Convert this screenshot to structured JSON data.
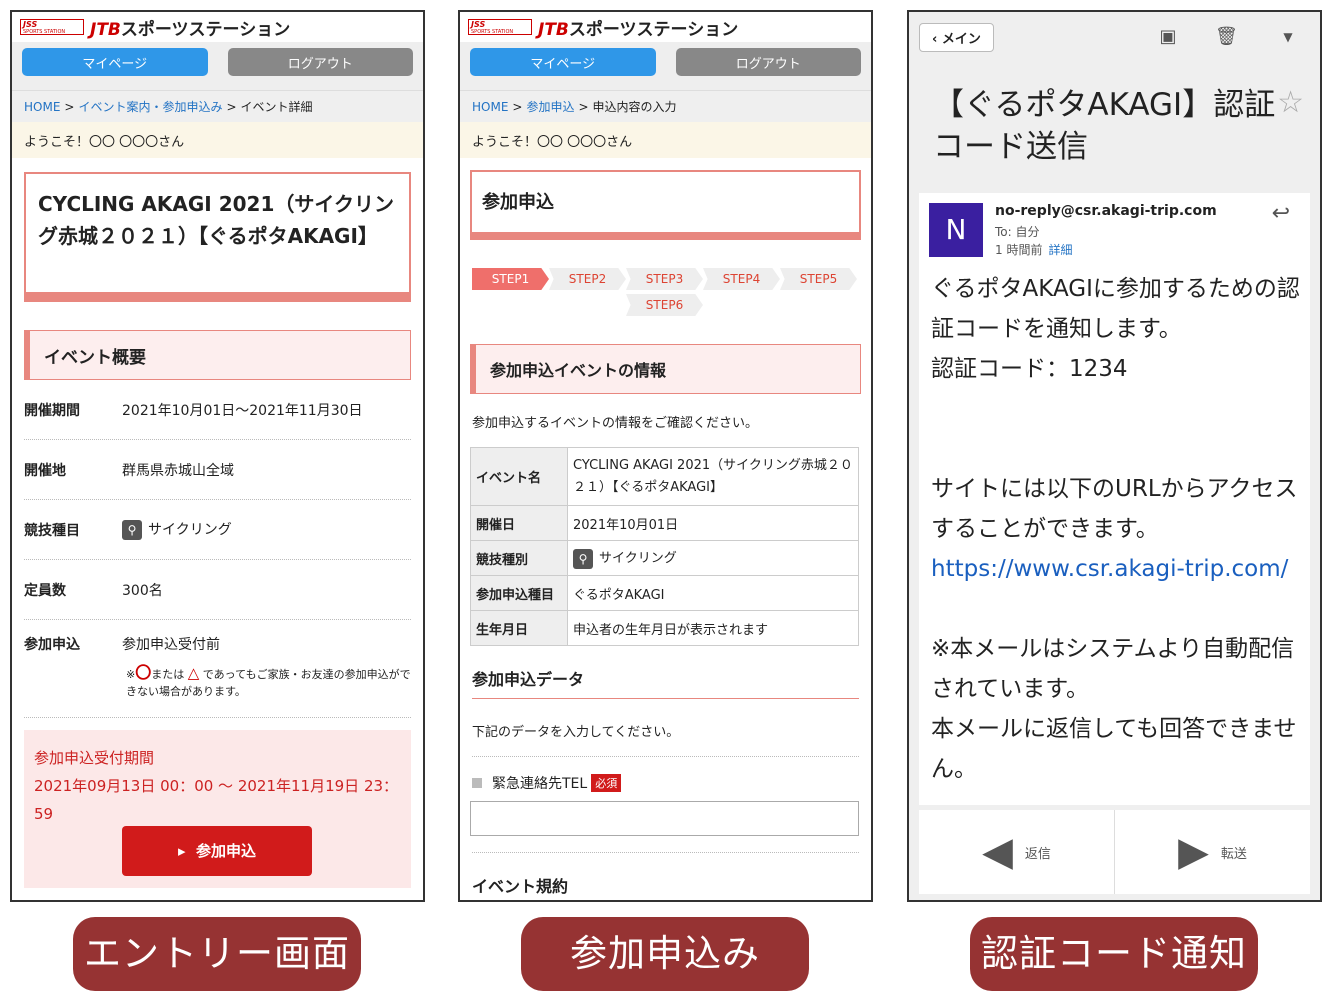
{
  "header": {
    "logo_line1": "JSS",
    "logo_line2": "SPORTS STATION",
    "brand_jtb": "JTB",
    "brand_rest": "スポーツステーション",
    "mypage": "マイページ",
    "logout": "ログアウト",
    "welcome": "ようこそ！〇〇 〇〇〇さん"
  },
  "screen1": {
    "crumb_home": "HOME",
    "crumb_events": "イベント案内・参加申込み",
    "crumb_current": "イベント詳細",
    "event_title": "CYCLING AKAGI 2021（サイクリング赤城２０２１）【ぐるポタAKAGI】",
    "overview_heading": "イベント概要",
    "rows": [
      {
        "key": "開催期間",
        "value": "2021年10月01日〜2021年11月30日"
      },
      {
        "key": "開催地",
        "value": "群馬県赤城山全域"
      },
      {
        "key": "競技種目",
        "value": "サイクリング"
      },
      {
        "key": "定員数",
        "value": "300名"
      }
    ],
    "apply_key": "参加申込",
    "apply_value": "参加申込受付前",
    "note_prefix": "※",
    "note_mark_o": "〇",
    "note_or": "または",
    "note_mark_t": "△",
    "note_rest": "であってもご家族・お友達の参加申込ができない場合があります。",
    "period_label": "参加申込受付期間",
    "period_value": "2021年09月13日 00：00 〜 2021年11月19日 23：59",
    "apply_button": "参加申込"
  },
  "screen2": {
    "crumb_home": "HOME",
    "crumb_apply": "参加申込",
    "crumb_current": "申込内容の入力",
    "title": "参加申込",
    "steps": [
      "STEP1",
      "STEP2",
      "STEP3",
      "STEP4",
      "STEP5",
      "STEP6"
    ],
    "info_heading": "参加申込イベントの情報",
    "info_desc": "参加申込するイベントの情報をご確認ください。",
    "table": [
      {
        "key": "イベント名",
        "value": "CYCLING AKAGI 2021（サイクリング赤城２０２１）【ぐるポタAKAGI】"
      },
      {
        "key": "開催日",
        "value": "2021年10月01日"
      },
      {
        "key": "競技種別",
        "value": "サイクリング"
      },
      {
        "key": "参加申込種目",
        "value": "ぐるポタAKAGI"
      },
      {
        "key": "生年月日",
        "value": "申込者の生年月日が表示されます"
      }
    ],
    "data_heading": "参加申込データ",
    "data_desc": "下記のデータを入力してください。",
    "tel_label": "緊急連絡先TEL",
    "required": "必須",
    "tel_value": "",
    "terms_heading": "イベント規約"
  },
  "screen3": {
    "main_button": "メイン",
    "subject": "【ぐるポタAKAGI】認証コード送信",
    "avatar_letter": "N",
    "from": "no-reply@csr.akagi-trip.com",
    "to": "To: 自分",
    "time": "1 時間前",
    "detail": "詳細",
    "body_line1": "ぐるポタAKAGIに参加するための認証コードを通知します。",
    "body_line2": "認証コード：1234",
    "body_line3": "サイトには以下のURLからアクセスすることができます。",
    "body_url": "https://www.csr.akagi-trip.com/",
    "body_line4": "※本メールはシステムより自動配信されています。",
    "body_line5": "本メールに返信しても回答できません。",
    "reply": "返信",
    "forward": "転送"
  },
  "captions": {
    "entry": "エントリー画面",
    "apply": "参加申込み",
    "auth": "認証コード通知"
  }
}
